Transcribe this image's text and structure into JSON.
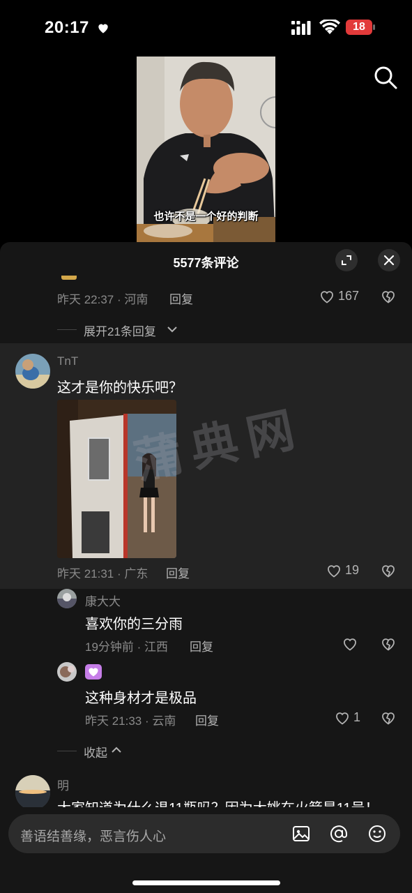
{
  "status_bar": {
    "time": "20:17",
    "battery": "18",
    "battery_color": "#e23a3a"
  },
  "video": {
    "subtitle": "也许不是一个好的判断"
  },
  "sheet": {
    "title": "5577条评论"
  },
  "comments": {
    "first": {
      "time_location": "昨天 22:37 · 河南",
      "reply": "回复",
      "likes": "167"
    },
    "expand": "展开21条回复",
    "main": {
      "author": "TnT",
      "text": "这才是你的快乐吧？",
      "time_location": "昨天 21:31 · 广东",
      "reply": "回复",
      "likes": "19"
    },
    "watermark": "蒲典网",
    "reply1": {
      "author": "康大大",
      "text": "喜欢你的三分雨",
      "time_location": "19分钟前 · 江西",
      "reply": "回复"
    },
    "reply2": {
      "text": "这种身材才是极品",
      "time_location": "昨天 21:33 · 云南",
      "reply": "回复",
      "likes": "1"
    },
    "collapse": "收起",
    "next": {
      "author": "明",
      "text": "大家知道为什么退11瓶吗？因为大姚在火箭是11号！"
    }
  },
  "input": {
    "placeholder": "善语结善缘，恶言伤人心"
  },
  "colors": {
    "sheet_bg": "#161616",
    "highlight_bg": "#232323",
    "meta_gray": "#8a8a8a",
    "badge_purple": "#c67ee8"
  }
}
